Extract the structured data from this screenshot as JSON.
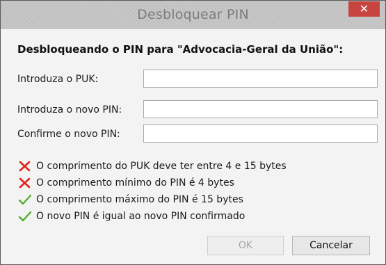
{
  "window": {
    "title": "Desbloquear PIN",
    "close_label": "✕"
  },
  "heading": "Desbloqueando o PIN para \"Advocacia-Geral da União\":",
  "fields": [
    {
      "label": "Introduza o PUK:",
      "value": ""
    },
    {
      "label": "Introduza o novo PIN:",
      "value": ""
    },
    {
      "label": "Confirme o novo PIN:",
      "value": ""
    }
  ],
  "messages": [
    {
      "text": "O comprimento do PUK deve ter entre 4 e 15 bytes",
      "status": "error",
      "icon": "cross-icon"
    },
    {
      "text": "O comprimento mínimo do PIN é 4 bytes",
      "status": "error",
      "icon": "cross-icon"
    },
    {
      "text": "O comprimento máximo do PIN é 15 bytes",
      "status": "ok",
      "icon": "check-icon"
    },
    {
      "text": "O novo PIN é igual ao novo PIN confirmado",
      "status": "ok",
      "icon": "check-icon"
    }
  ],
  "buttons": {
    "ok_label": "OK",
    "cancel_label": "Cancelar"
  },
  "colors": {
    "error": "#e2231a",
    "ok": "#4fae2e",
    "close_bg": "#c7453e"
  }
}
